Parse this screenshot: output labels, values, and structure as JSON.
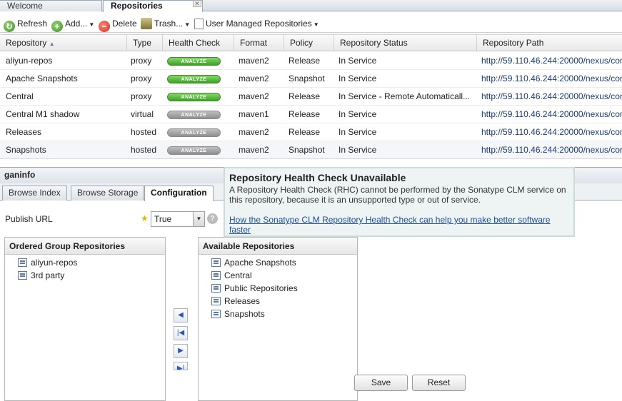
{
  "tabs": [
    {
      "label": "Welcome"
    },
    {
      "label": "Repositories"
    }
  ],
  "toolbar": {
    "refresh": "Refresh",
    "add": "Add...",
    "delete": "Delete",
    "trash": "Trash...",
    "user_managed": "User Managed Repositories"
  },
  "grid": {
    "columns": [
      "Repository",
      "Type",
      "Health Check",
      "Format",
      "Policy",
      "Repository Status",
      "Repository Path"
    ],
    "analyze_label": "ANALYZE",
    "rows": [
      {
        "repository": "aliyun-repos",
        "type": "proxy",
        "format": "maven2",
        "policy": "Release",
        "status": "In Service",
        "path": "http://59.110.46.244:20000/nexus/cont"
      },
      {
        "repository": "Apache Snapshots",
        "type": "proxy",
        "format": "maven2",
        "policy": "Snapshot",
        "status": "In Service",
        "path": "http://59.110.46.244:20000/nexus/cont"
      },
      {
        "repository": "Central",
        "type": "proxy",
        "format": "maven2",
        "policy": "Release",
        "status": "In Service - Remote Automaticall...",
        "path": "http://59.110.46.244:20000/nexus/cont"
      },
      {
        "repository": "Central M1 shadow",
        "type": "virtual",
        "format": "maven1",
        "policy": "Release",
        "status": "In Service",
        "path": "http://59.110.46.244:20000/nexus/cont"
      },
      {
        "repository": "Releases",
        "type": "hosted",
        "format": "maven2",
        "policy": "Release",
        "status": "In Service",
        "path": "http://59.110.46.244:20000/nexus/cont"
      },
      {
        "repository": "Snapshots",
        "type": "hosted",
        "format": "maven2",
        "policy": "Snapshot",
        "status": "In Service",
        "path": "http://59.110.46.244:20000/nexus/cont"
      }
    ]
  },
  "panel": {
    "title": "ganinfo",
    "tabs": [
      "Browse Index",
      "Browse Storage",
      "Configuration"
    ],
    "publish_url_label": "Publish URL",
    "publish_url_value": "True",
    "ordered_title": "Ordered Group Repositories",
    "ordered_items": [
      "aliyun-repos",
      "3rd party"
    ],
    "available_title": "Available Repositories",
    "available_items": [
      "Apache Snapshots",
      "Central",
      "Public Repositories",
      "Releases",
      "Snapshots"
    ],
    "save_label": "Save",
    "reset_label": "Reset"
  },
  "tooltip": {
    "title": "Repository Health Check Unavailable",
    "body": "A Repository Health Check (RHC) cannot be performed by the Sonatype CLM service on this repository, because it is an unsupported type or out of service.",
    "link": "How the Sonatype CLM Repository Health Check can help you make better software faster"
  }
}
